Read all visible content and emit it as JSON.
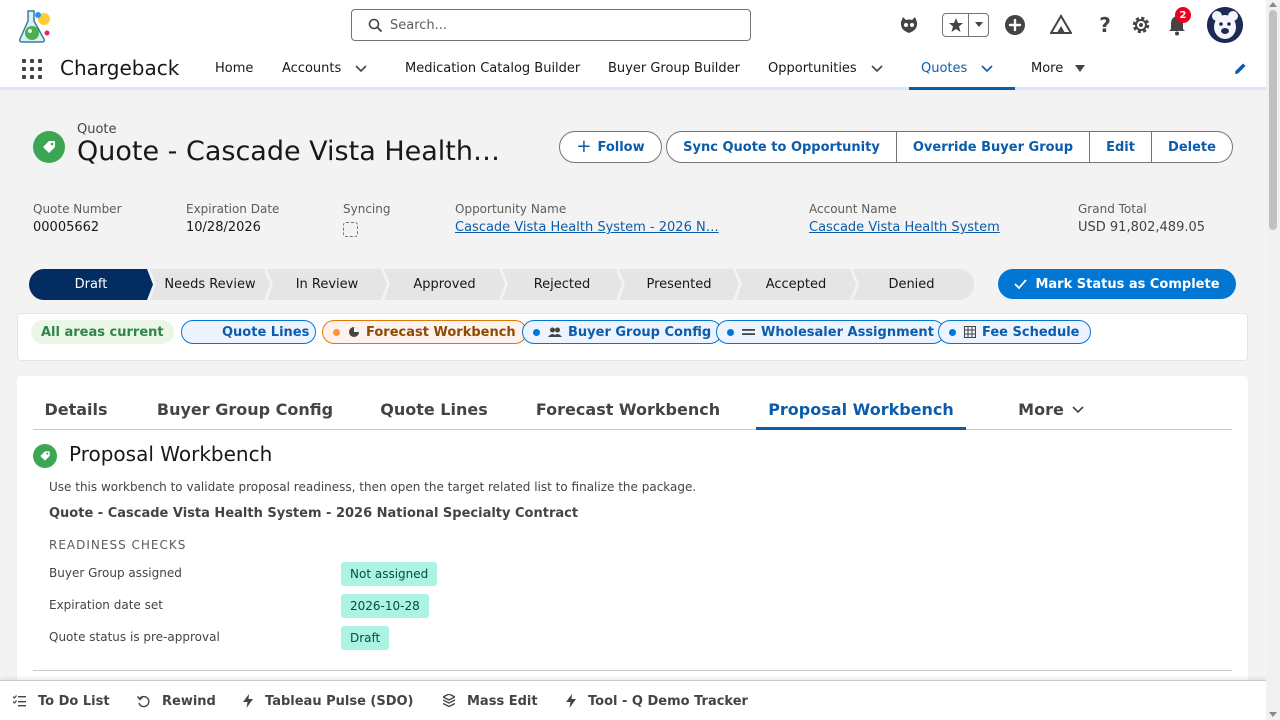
{
  "header": {
    "search_placeholder": "Search...",
    "notification_count": "2",
    "icons": [
      "app-logo-icon",
      "search-icon",
      "einstein-icon",
      "favorites-star-icon",
      "favorites-caret-icon",
      "global-add-icon",
      "trailhead-icon",
      "help-icon",
      "setup-gear-icon",
      "notifications-bell-icon",
      "user-avatar"
    ]
  },
  "nav": {
    "app_name": "Chargeback",
    "items": [
      {
        "label": "Home"
      },
      {
        "label": "Accounts"
      },
      {
        "label": "Medication Catalog Builder"
      },
      {
        "label": "Buyer Group Builder"
      },
      {
        "label": "Opportunities"
      },
      {
        "label": "Quotes"
      },
      {
        "label": "More"
      }
    ],
    "active": "Quotes"
  },
  "record": {
    "type_label": "Quote",
    "title": "Quote - Cascade Vista Health…",
    "actions": {
      "follow": "Follow",
      "sync": "Sync Quote to Opportunity",
      "override": "Override Buyer Group",
      "edit": "Edit",
      "delete": "Delete"
    },
    "fields": {
      "quote_number_label": "Quote Number",
      "quote_number": "00005662",
      "expiration_label": "Expiration Date",
      "expiration": "10/28/2026",
      "syncing_label": "Syncing",
      "opportunity_label": "Opportunity Name",
      "opportunity": "Cascade Vista Health System - 2026 N…",
      "account_label": "Account Name",
      "account": "Cascade Vista Health System",
      "grand_total_label": "Grand Total",
      "grand_total": "USD 91,802,489.05"
    }
  },
  "path": {
    "steps": [
      "Draft",
      "Needs Review",
      "In Review",
      "Approved",
      "Rejected",
      "Presented",
      "Accepted",
      "Denied"
    ],
    "current": "Draft",
    "mark_complete": "Mark Status as Complete",
    "colors": {
      "current": "#032d60",
      "incomplete": "#e5e5e5"
    }
  },
  "areas": {
    "status": "All areas current",
    "chips": [
      {
        "label": "Quote Lines",
        "dot": "#0176d3"
      },
      {
        "label": "Forecast Workbench",
        "dot": "#fe9339",
        "icon": "pie-chart-icon"
      },
      {
        "label": "Buyer Group Config",
        "dot": "#0176d3",
        "icon": "people-icon"
      },
      {
        "label": "Wholesaler Assignment",
        "dot": "#0176d3",
        "icon": "lines-icon"
      },
      {
        "label": "Fee Schedule",
        "dot": "#0176d3",
        "icon": "table-icon"
      }
    ]
  },
  "tabs": {
    "items": [
      "Details",
      "Buyer Group Config",
      "Quote Lines",
      "Forecast Workbench",
      "Proposal Workbench"
    ],
    "more": "More",
    "active": "Proposal Workbench"
  },
  "workbench": {
    "title": "Proposal Workbench",
    "description": "Use this workbench to validate proposal readiness, then open the target related list to finalize the package.",
    "quote_name": "Quote - Cascade Vista Health System - 2026 National Specialty Contract",
    "section": "READINESS CHECKS",
    "checks": [
      {
        "label": "Buyer Group assigned",
        "status": "Not assigned"
      },
      {
        "label": "Expiration date set",
        "status": "2026-10-28"
      },
      {
        "label": "Quote status is pre-approval",
        "status": "Draft"
      }
    ]
  },
  "utility_bar": {
    "items": [
      {
        "label": "To Do List",
        "icon": "checklist-icon"
      },
      {
        "label": "Rewind",
        "icon": "rewind-icon"
      },
      {
        "label": "Tableau Pulse (SDO)",
        "icon": "bolt-icon"
      },
      {
        "label": "Mass Edit",
        "icon": "layers-icon"
      },
      {
        "label": "Tool - Q Demo Tracker",
        "icon": "bolt-icon"
      }
    ]
  },
  "colors": {
    "brand": "#0176d3",
    "link": "#0b5cab",
    "success": "#3ba755",
    "pill": "#acf3e4"
  }
}
